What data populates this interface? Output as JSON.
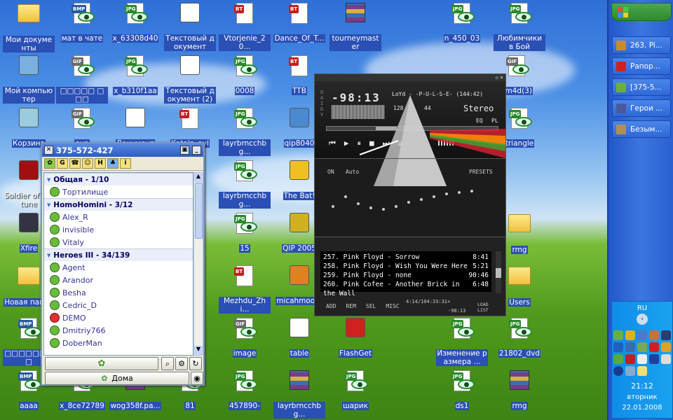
{
  "desktop_icons": [
    {
      "label": "Мои документы",
      "type": "folder",
      "sel": true
    },
    {
      "label": "мат в чате",
      "type": "bmp",
      "sel": true
    },
    {
      "label": "x_63308d40",
      "type": "jpg",
      "sel": true
    },
    {
      "label": "Текстовый документ",
      "type": "txt",
      "sel": true
    },
    {
      "label": "Vtorjenie_20...",
      "type": "bt",
      "sel": true
    },
    {
      "label": "Dance_Of_T...",
      "type": "bt",
      "sel": true
    },
    {
      "label": "tourneymaster",
      "type": "rar",
      "sel": true
    },
    {
      "label": "n_450_03",
      "type": "jpg",
      "sel": true
    },
    {
      "label": "Любимчики в Бой",
      "type": "jpg",
      "sel": true
    },
    {
      "label": "Мой компьютер",
      "type": "pc",
      "sel": true
    },
    {
      "label": "□□□□□ □□□",
      "type": "gif",
      "sel": true
    },
    {
      "label": "x_b310f1aa",
      "type": "jpg",
      "sel": true
    },
    {
      "label": "Текстовый документ (2)",
      "type": "txt",
      "sel": true
    },
    {
      "label": "0008",
      "type": "jpg",
      "sel": true
    },
    {
      "label": "TTB",
      "type": "bt",
      "sel": true
    },
    {
      "label": "sm4d(3)",
      "type": "gif",
      "sel": true
    },
    {
      "label": "Корзина",
      "type": "bin",
      "sel": true
    },
    {
      "label": "ava",
      "type": "gif",
      "sel": true
    },
    {
      "label": "Документ",
      "type": "doc",
      "sel": true
    },
    {
      "label": "Katala_avi",
      "type": "bt",
      "sel": true
    },
    {
      "label": "layrbrncchbg...",
      "type": "jpg",
      "sel": true
    },
    {
      "label": "qip8040",
      "type": "app",
      "sel": true
    },
    {
      "label": "triangle",
      "type": "jpg",
      "sel": true
    },
    {
      "label": "Soldier of Fortune",
      "type": "sof",
      "sel": false
    },
    {
      "label": "layrbrncchbg...",
      "type": "jpg",
      "sel": true
    },
    {
      "label": "The Bat!",
      "type": "bat",
      "sel": true
    },
    {
      "label": "Xfire",
      "type": "xfire",
      "sel": true
    },
    {
      "label": "15",
      "type": "jpg",
      "sel": true
    },
    {
      "label": "QIP 2005",
      "type": "qip",
      "sel": true
    },
    {
      "label": "rmg",
      "type": "folder",
      "sel": true
    },
    {
      "label": "Новая папка",
      "type": "folder",
      "sel": true
    },
    {
      "label": "Mezhdu_Zhi...",
      "type": "bt",
      "sel": true
    },
    {
      "label": "micahmoore",
      "type": "media",
      "sel": true
    },
    {
      "label": "Users",
      "type": "folder",
      "sel": true
    },
    {
      "label": "□□□□□□□□",
      "type": "bmp",
      "sel": true
    },
    {
      "label": "image",
      "type": "gif",
      "sel": true
    },
    {
      "label": "table",
      "type": "txt",
      "sel": true
    },
    {
      "label": "FlashGet",
      "type": "flashget",
      "sel": true
    },
    {
      "label": "Изменение размера ...",
      "type": "jpg",
      "sel": true
    },
    {
      "label": "21802_dvd",
      "type": "jpg",
      "sel": true
    },
    {
      "label": "aaaa",
      "type": "bmp",
      "sel": true
    },
    {
      "label": "x_8ce72789",
      "type": "bmp",
      "sel": true
    },
    {
      "label": "wog358f.pa...",
      "type": "rar",
      "sel": true
    },
    {
      "label": "81",
      "type": "jpg",
      "sel": true
    },
    {
      "label": "457890-",
      "type": "jpg",
      "sel": true
    },
    {
      "label": "layrbrncchbg...",
      "type": "rar",
      "sel": true
    },
    {
      "label": "шарик",
      "type": "jpg",
      "sel": true
    },
    {
      "label": "ds1",
      "type": "jpg",
      "sel": true
    },
    {
      "label": "rmg",
      "type": "rar",
      "sel": true
    }
  ],
  "taskbar": {
    "start_label": "",
    "items": [
      {
        "label": "263. Pi...",
        "color": "#c88a30"
      },
      {
        "label": "Рапор...",
        "color": "#d02020"
      },
      {
        "label": "[375-5...",
        "color": "#6ab040"
      },
      {
        "label": "Герои ...",
        "color": "#4a5a9a"
      },
      {
        "label": "Безым...",
        "color": "#b09050"
      }
    ],
    "lang": "RU",
    "time": "21:12",
    "day": "вторник",
    "date": "22.01.2008"
  },
  "icq": {
    "title": "375-572-427",
    "status_label": "Дома",
    "groups": [
      {
        "name": "Общая - 1/10",
        "contacts": [
          {
            "name": "Тортилище",
            "status": "online"
          }
        ]
      },
      {
        "name": "HomoHomini - 3/12",
        "contacts": [
          {
            "name": "Alex_R",
            "status": "online"
          },
          {
            "name": "invisible",
            "status": "invisible"
          },
          {
            "name": "Vitaly",
            "status": "online"
          }
        ]
      },
      {
        "name": "Heroes III - 34/139",
        "contacts": [
          {
            "name": "Agent",
            "status": "online"
          },
          {
            "name": "Arandor",
            "status": "online"
          },
          {
            "name": "Besha",
            "status": "online"
          },
          {
            "name": "Cedric_D",
            "status": "online"
          },
          {
            "name": "DEMO",
            "status": "dnd"
          },
          {
            "name": "Dmitriy766",
            "status": "online"
          },
          {
            "name": "DoberMan",
            "status": "online"
          }
        ]
      }
    ]
  },
  "winamp": {
    "sidebar_label": "OAIDV",
    "time": "-98:13",
    "track_title": "LoYd - -P-U-L-S-E- (144:42)",
    "kbps": "128",
    "khz": "44",
    "stereo": "Stereo",
    "eq_label": "EQ",
    "pl_label": "PL",
    "eq_on": "ON",
    "eq_auto": "Auto",
    "presets": "PRESETS",
    "playlist": [
      {
        "title": "257. Pink Floyd - Sorrow",
        "len": "8:41"
      },
      {
        "title": "258. Pink Floyd - Wish You Were Here",
        "len": "5:21"
      },
      {
        "title": "259. Pink Floyd - none",
        "len": "90:46"
      },
      {
        "title": "260. Pink Cofee - Another Brick in the Wall",
        "len": "6:48"
      }
    ],
    "pl_buttons": [
      "ADD",
      "REM",
      "SEL",
      "MISC"
    ],
    "pl_time": "4:14/104:33:31+",
    "pl_remaining": "-98:13",
    "load_list": "LOAD LIST"
  }
}
